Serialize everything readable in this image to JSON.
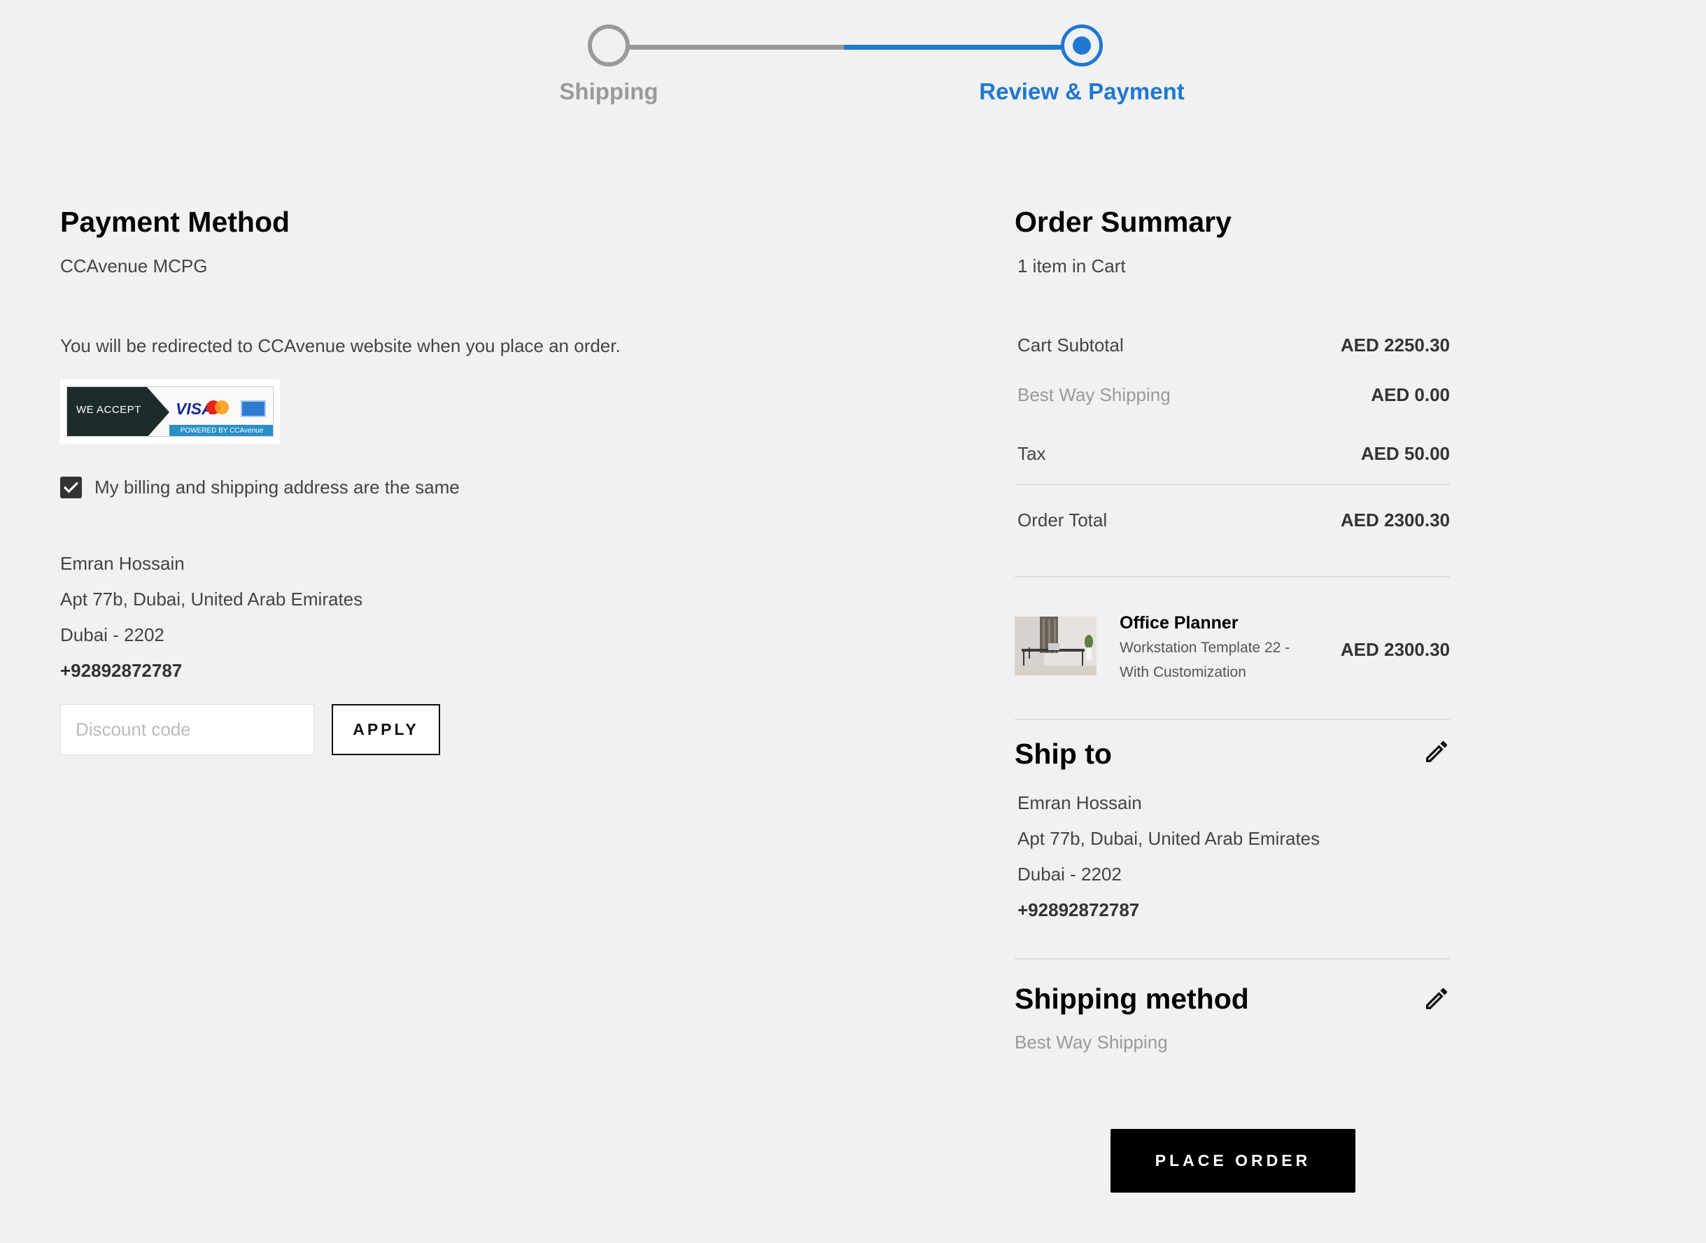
{
  "progress": {
    "steps": [
      {
        "label": "Shipping"
      },
      {
        "label": "Review & Payment"
      }
    ]
  },
  "payment": {
    "title": "Payment Method",
    "method": "CCAvenue MCPG",
    "redirect_note": "You will be redirected to CCAvenue website when you place an order.",
    "badge": {
      "we_accept": "WE ACCEPT",
      "visa": "VISA",
      "powered_by": "POWERED BY CCAvenue"
    },
    "same_address_label": "My billing and shipping address are the same",
    "same_address_checked": true,
    "billing": {
      "name": "Emran Hossain",
      "street": "Apt 77b, Dubai, United Arab Emirates",
      "city_zip": "Dubai - 2202",
      "phone": "+92892872787"
    },
    "discount_placeholder": "Discount code",
    "apply_label": "APPLY"
  },
  "summary": {
    "title": "Order Summary",
    "items_in_cart": "1 item in Cart",
    "rows": {
      "subtotal_label": "Cart Subtotal",
      "subtotal_value": "AED 2250.30",
      "shipping_label": "Best Way Shipping",
      "shipping_value": "AED 0.00",
      "tax_label": "Tax",
      "tax_value": "AED 50.00",
      "total_label": "Order Total",
      "total_value": "AED 2300.30"
    },
    "item": {
      "name": "Office Planner",
      "desc_line1": "Workstation Template 22 -",
      "desc_line2": "With Customization",
      "price": "AED 2300.30"
    },
    "ship_to": {
      "title": "Ship to",
      "name": "Emran Hossain",
      "street": "Apt 77b, Dubai, United Arab Emirates",
      "city_zip": "Dubai - 2202",
      "phone": "+92892872787"
    },
    "shipping_method": {
      "title": "Shipping method",
      "value": "Best Way Shipping"
    }
  },
  "place_order_label": "PLACE ORDER",
  "colors": {
    "accent": "#1f78d1",
    "background": "#f1f1f1",
    "button": "#000000"
  }
}
